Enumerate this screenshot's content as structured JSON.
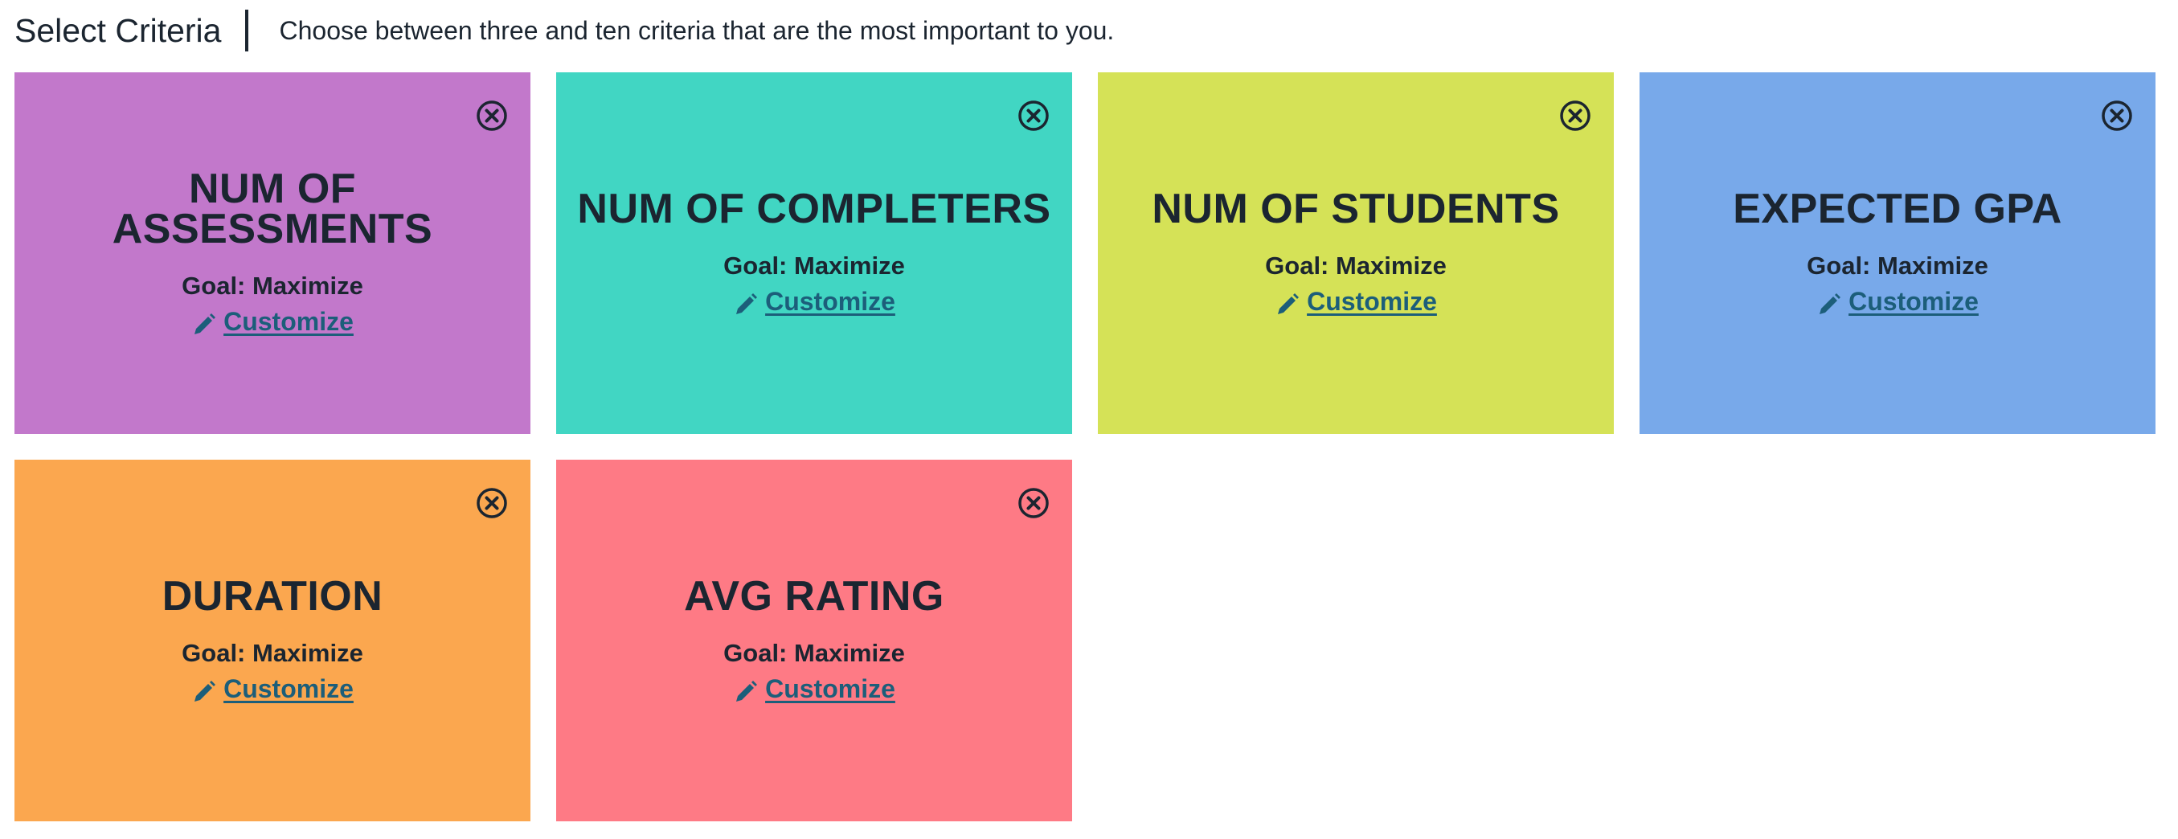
{
  "header": {
    "title": "Select Criteria",
    "description": "Choose between three and ten criteria that are the most important to you."
  },
  "cards": [
    {
      "title": "NUM OF ASSESSMENTS",
      "goal": "Goal: Maximize",
      "customize": "Customize",
      "color": "#c278cb"
    },
    {
      "title": "NUM OF COMPLETERS",
      "goal": "Goal: Maximize",
      "customize": "Customize",
      "color": "#41d6c3"
    },
    {
      "title": "NUM OF STUDENTS",
      "goal": "Goal: Maximize",
      "customize": "Customize",
      "color": "#d5e257"
    },
    {
      "title": "EXPECTED GPA",
      "goal": "Goal: Maximize",
      "customize": "Customize",
      "color": "#78a9ea"
    },
    {
      "title": "DURATION",
      "goal": "Goal: Maximize",
      "customize": "Customize",
      "color": "#fba74f"
    },
    {
      "title": "AVG RATING",
      "goal": "Goal: Maximize",
      "customize": "Customize",
      "color": "#fe7a85"
    }
  ],
  "icons": {
    "close": "close-circle-icon",
    "edit": "pencil-icon"
  },
  "colors": {
    "text": "#1b2530",
    "link": "#1c5e7a"
  }
}
